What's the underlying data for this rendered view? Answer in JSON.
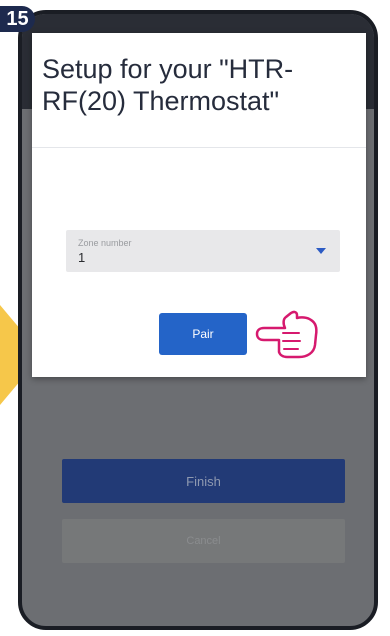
{
  "step": {
    "number": "15"
  },
  "dialog": {
    "title": "Setup for your \"HTR-RF(20) Thermostat\"",
    "zone_field": {
      "label": "Zone number",
      "value": "1"
    },
    "pair_label": "Pair"
  },
  "background_screen": {
    "finish_label": "Finish",
    "cancel_label": "Cancel"
  },
  "colors": {
    "badge": "#1d2a4e",
    "arrow": "#f6c74a",
    "pair_button": "#2464c8",
    "pointer_outline": "#d6196e",
    "finish_button": "#223a76"
  },
  "icons": [
    "pointing-hand-icon",
    "chevron-down-icon",
    "yellow-arrow-icon"
  ]
}
